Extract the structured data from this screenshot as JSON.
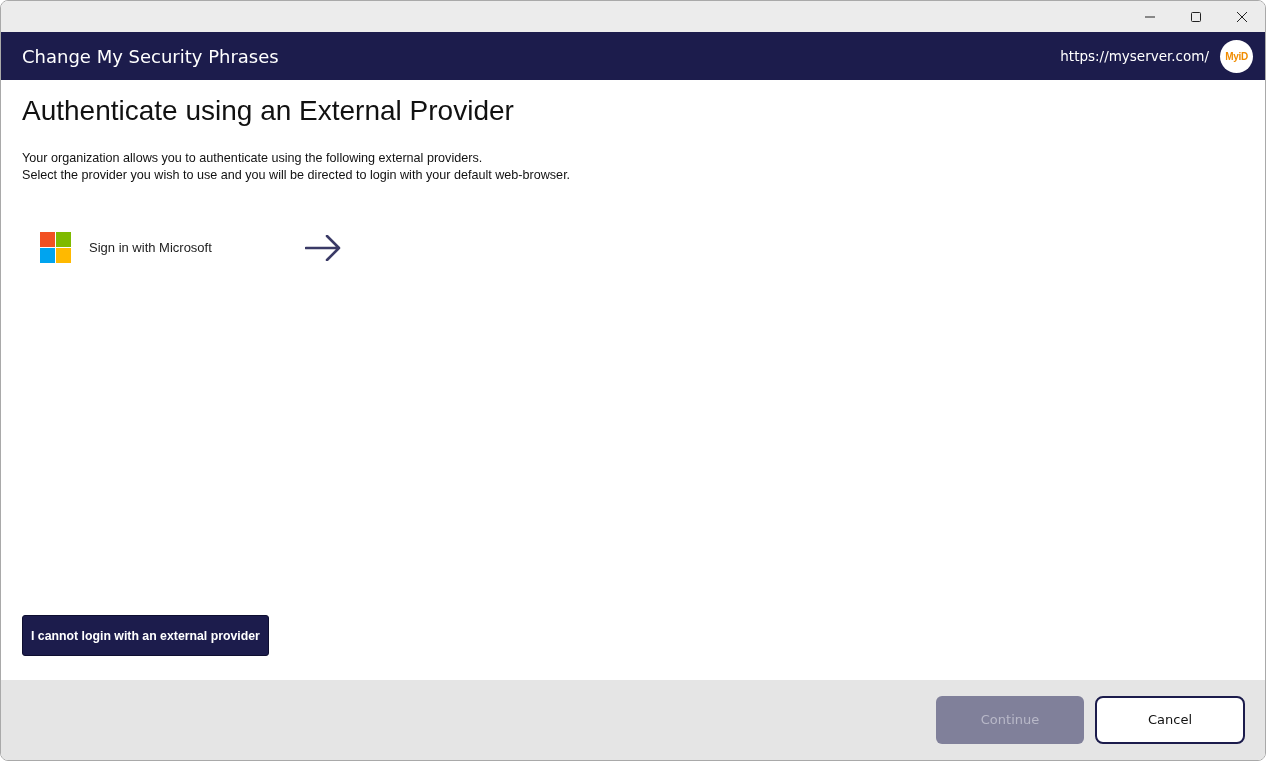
{
  "window": {
    "controls": [
      {
        "kind": "minimize"
      },
      {
        "kind": "maximize"
      },
      {
        "kind": "close"
      }
    ]
  },
  "header": {
    "title": "Change My Security Phrases",
    "server_url": "https://myserver.com/",
    "logo": "MyiD"
  },
  "content": {
    "heading": "Authenticate using an External Provider",
    "description": [
      "Your organization allows you to authenticate using the following external providers.",
      "Select the provider you wish to use and you will be directed to login with your default web-browser."
    ],
    "providers": [
      {
        "kind": "microsoft",
        "label": "Sign in with Microsoft"
      }
    ],
    "fallback_button": "I cannot login with an external provider"
  },
  "footer": {
    "buttons": [
      {
        "kind": "primary",
        "label": "Continue",
        "disabled": true
      },
      {
        "kind": "secondary",
        "label": "Cancel",
        "disabled": false
      }
    ]
  }
}
